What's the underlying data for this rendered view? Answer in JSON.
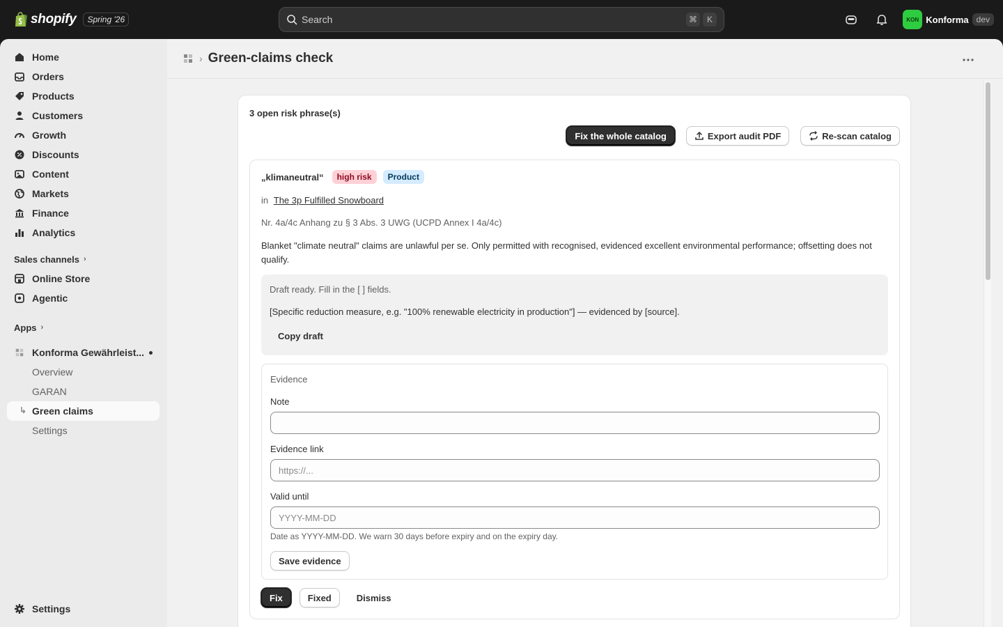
{
  "topbar": {
    "brand": "shopify",
    "edition": "Spring '26",
    "search_placeholder": "Search",
    "shortcut_keys": [
      "⌘",
      "K"
    ],
    "store_initials": "KON",
    "store_name": "Konforma",
    "env_badge": "dev"
  },
  "sidebar": {
    "items": [
      {
        "label": "Home",
        "icon": "home-icon"
      },
      {
        "label": "Orders",
        "icon": "inbox-icon"
      },
      {
        "label": "Products",
        "icon": "tag-icon"
      },
      {
        "label": "Customers",
        "icon": "person-icon"
      },
      {
        "label": "Growth",
        "icon": "gauge-icon"
      },
      {
        "label": "Discounts",
        "icon": "discount-icon"
      },
      {
        "label": "Content",
        "icon": "content-icon"
      },
      {
        "label": "Markets",
        "icon": "globe-icon"
      },
      {
        "label": "Finance",
        "icon": "bank-icon"
      },
      {
        "label": "Analytics",
        "icon": "bar-chart-icon"
      }
    ],
    "sales_channels_label": "Sales channels",
    "channels": [
      {
        "label": "Online Store",
        "icon": "store-icon"
      },
      {
        "label": "Agentic",
        "icon": "agent-icon"
      }
    ],
    "apps_label": "Apps",
    "app_name": "Konforma Gewährleist...",
    "app_sub": [
      "Overview",
      "GARAN",
      "Green claims",
      "Settings"
    ],
    "settings_label": "Settings"
  },
  "page": {
    "title": "Green-claims check"
  },
  "card": {
    "title": "3 open risk phrase(s)",
    "actions": {
      "fix_all": "Fix the whole catalog",
      "export": "Export audit PDF",
      "rescan": "Re-scan catalog"
    }
  },
  "phrase": {
    "word": "„klimaneutral“",
    "risk_badge": "high risk",
    "type_badge": "Product",
    "in_prefix": "in",
    "product_link": "The 3p Fulfilled Snowboard",
    "law": "Nr. 4a/4c Anhang zu § 3 Abs. 3 UWG (UCPD Annex I 4a/4c)",
    "description": "Blanket \"climate neutral\" claims are unlawful per se. Only permitted with recognised, evidenced excellent environmental performance; offsetting does not qualify.",
    "draft_status": "Draft ready. Fill in the [ ] fields.",
    "draft_text": "[Specific reduction measure, e.g. \"100% renewable electricity in production\"] — evidenced by [source].",
    "copy_draft": "Copy draft",
    "evidence": {
      "title": "Evidence",
      "note_label": "Note",
      "note_value": "",
      "link_label": "Evidence link",
      "link_placeholder": "https://...",
      "valid_label": "Valid until",
      "valid_placeholder": "YYYY-MM-DD",
      "help": "Date as YYYY-MM-DD. We warn 30 days before expiry and on the expiry day.",
      "save": "Save evidence"
    },
    "actions": {
      "fix": "Fix",
      "fixed": "Fixed",
      "dismiss": "Dismiss"
    }
  },
  "colors": {
    "topbar_bg": "#1a1a1a",
    "risk_badge_bg": "#fed1d7",
    "type_badge_bg": "#d5ebff",
    "store_avatar": "#2ecc40"
  }
}
